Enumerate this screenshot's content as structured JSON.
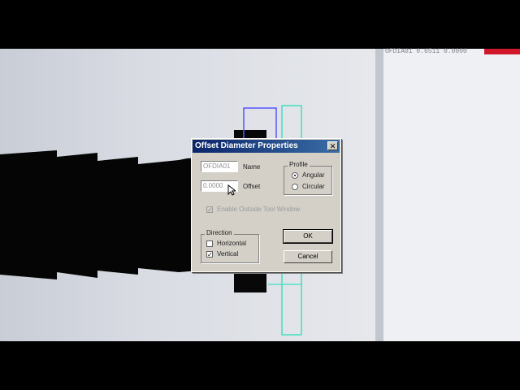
{
  "dialog": {
    "title": "Offset Diameter Properties",
    "close_glyph": "✕",
    "name_value": "OFDIA01",
    "name_label": "Name",
    "offset_value": "0.0000",
    "offset_label": "Offset",
    "profile": {
      "title": "Profile",
      "options": [
        "Angular",
        "Circular"
      ],
      "selected": "Angular"
    },
    "enable_outside": {
      "label": "Enable Outside Tool Window",
      "checked": true,
      "disabled": true
    },
    "direction": {
      "title": "Direction",
      "horizontal": {
        "label": "Horizontal",
        "checked": false
      },
      "vertical": {
        "label": "Vertical",
        "checked": true
      }
    },
    "ok_label": "OK",
    "cancel_label": "Cancel"
  },
  "readout": {
    "text": "OFDIA01  0.6511  0.0000"
  },
  "colors": {
    "titlebar": "#0a246a",
    "dialog_face": "#d4d0c8",
    "tool_blue": "#5555ff",
    "tool_cyan": "#40e0c0",
    "readout_red": "#d0182a"
  }
}
